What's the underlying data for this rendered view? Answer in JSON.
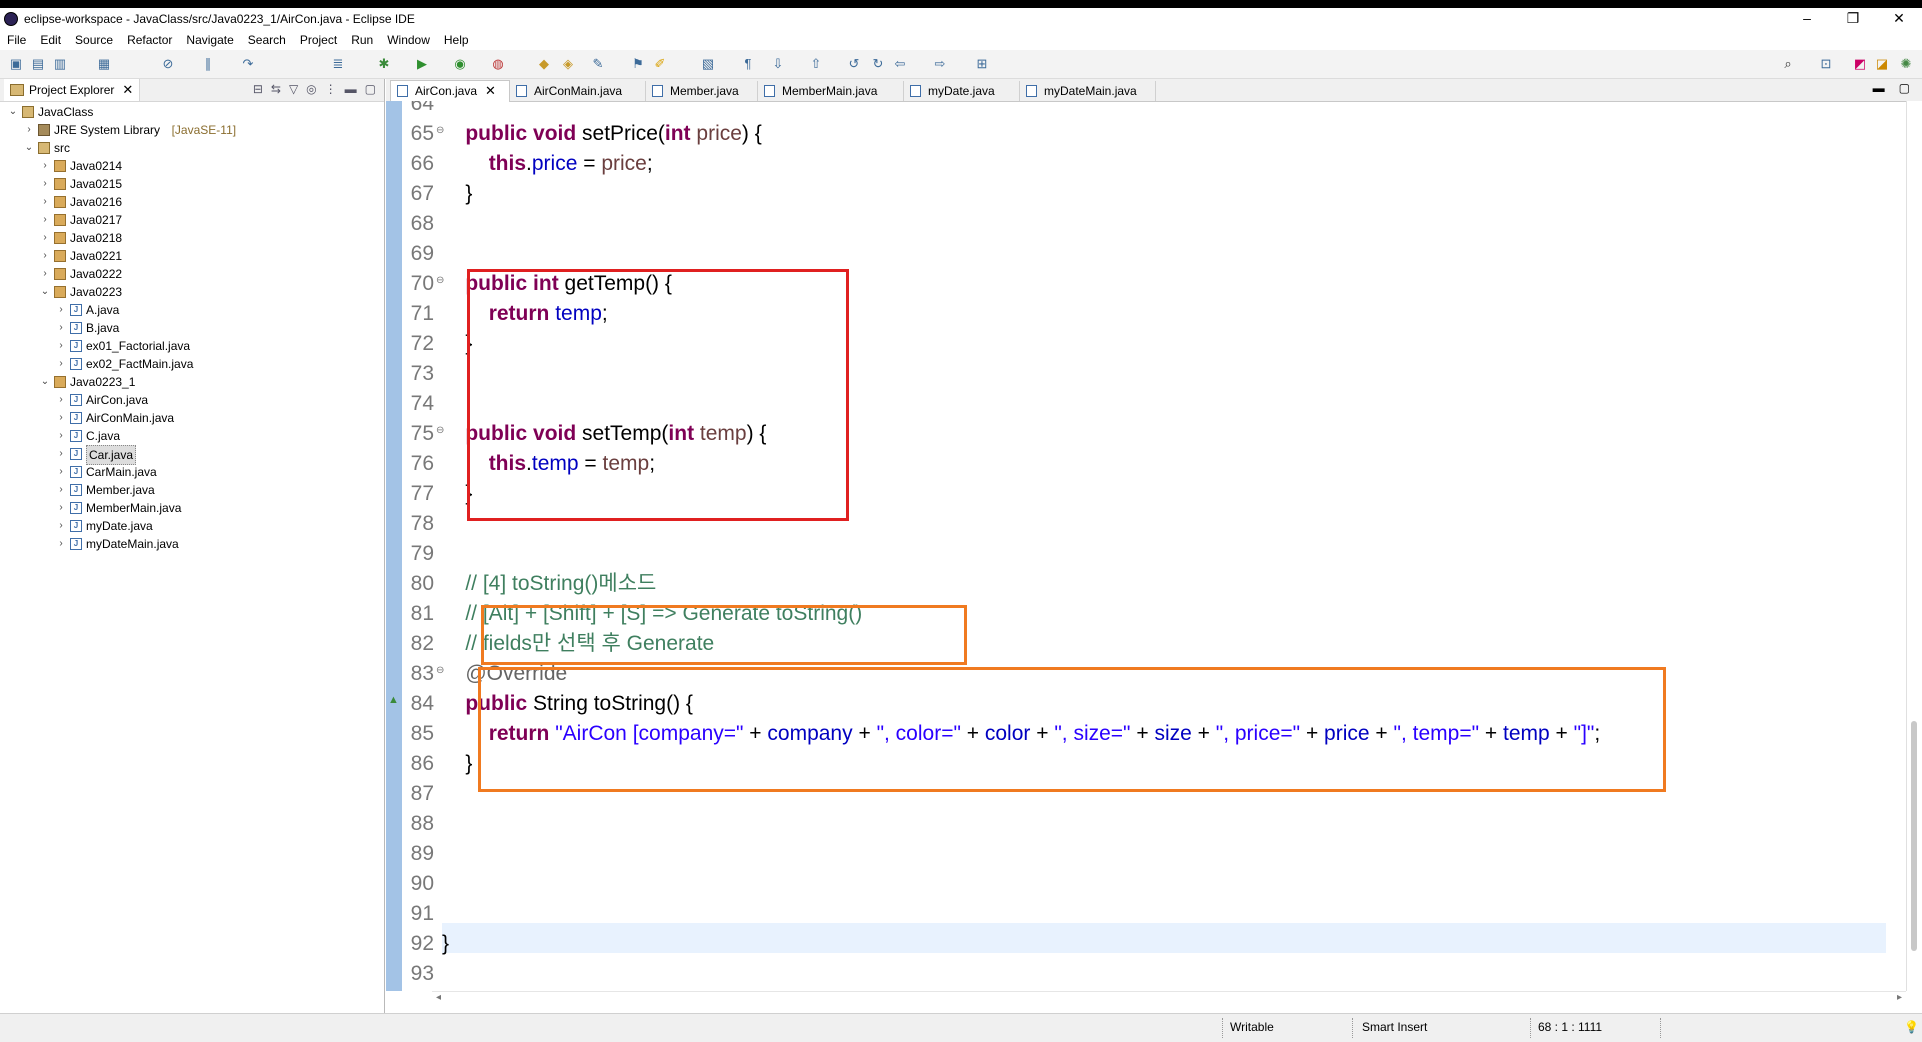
{
  "window": {
    "title": "eclipse-workspace - JavaClass/src/Java0223_1/AirCon.java - Eclipse IDE",
    "minimize": "–",
    "maximize": "❐",
    "close": "✕"
  },
  "menu": [
    "File",
    "Edit",
    "Source",
    "Refactor",
    "Navigate",
    "Search",
    "Project",
    "Run",
    "Window",
    "Help"
  ],
  "explorer": {
    "title": "Project Explorer",
    "tree": [
      {
        "label": "JavaClass",
        "depth": 0,
        "open": true,
        "icon": "project-icon"
      },
      {
        "label": "JRE System Library",
        "sub": "[JavaSE-11]",
        "depth": 1,
        "open": false,
        "icon": "library-icon"
      },
      {
        "label": "src",
        "depth": 1,
        "open": true,
        "icon": "source-folder-icon"
      },
      {
        "label": "Java0214",
        "depth": 2,
        "open": false,
        "icon": "package-icon"
      },
      {
        "label": "Java0215",
        "depth": 2,
        "open": false,
        "icon": "package-icon"
      },
      {
        "label": "Java0216",
        "depth": 2,
        "open": false,
        "icon": "package-icon"
      },
      {
        "label": "Java0217",
        "depth": 2,
        "open": false,
        "icon": "package-icon"
      },
      {
        "label": "Java0218",
        "depth": 2,
        "open": false,
        "icon": "package-icon"
      },
      {
        "label": "Java0221",
        "depth": 2,
        "open": false,
        "icon": "package-icon"
      },
      {
        "label": "Java0222",
        "depth": 2,
        "open": false,
        "icon": "package-icon"
      },
      {
        "label": "Java0223",
        "depth": 2,
        "open": true,
        "icon": "package-icon"
      },
      {
        "label": "A.java",
        "depth": 3,
        "open": false,
        "icon": "java-file-icon"
      },
      {
        "label": "B.java",
        "depth": 3,
        "open": false,
        "icon": "java-file-icon"
      },
      {
        "label": "ex01_Factorial.java",
        "depth": 3,
        "open": false,
        "icon": "java-file-icon"
      },
      {
        "label": "ex02_FactMain.java",
        "depth": 3,
        "open": false,
        "icon": "java-file-icon"
      },
      {
        "label": "Java0223_1",
        "depth": 2,
        "open": true,
        "icon": "package-icon"
      },
      {
        "label": "AirCon.java",
        "depth": 3,
        "open": false,
        "icon": "java-file-icon"
      },
      {
        "label": "AirConMain.java",
        "depth": 3,
        "open": false,
        "icon": "java-file-icon"
      },
      {
        "label": "C.java",
        "depth": 3,
        "open": false,
        "icon": "java-file-icon"
      },
      {
        "label": "Car.java",
        "depth": 3,
        "open": false,
        "icon": "java-file-icon",
        "selected": true
      },
      {
        "label": "CarMain.java",
        "depth": 3,
        "open": false,
        "icon": "java-file-icon"
      },
      {
        "label": "Member.java",
        "depth": 3,
        "open": false,
        "icon": "java-file-icon"
      },
      {
        "label": "MemberMain.java",
        "depth": 3,
        "open": false,
        "icon": "java-file-icon"
      },
      {
        "label": "myDate.java",
        "depth": 3,
        "open": false,
        "icon": "java-file-icon"
      },
      {
        "label": "myDateMain.java",
        "depth": 3,
        "open": false,
        "icon": "java-file-icon"
      }
    ]
  },
  "editor": {
    "tabs": [
      {
        "label": "AirCon.java",
        "active": true
      },
      {
        "label": "AirConMain.java",
        "active": false
      },
      {
        "label": "Member.java",
        "active": false
      },
      {
        "label": "MemberMain.java",
        "active": false
      },
      {
        "label": "myDate.java",
        "active": false
      },
      {
        "label": "myDateMain.java",
        "active": false
      }
    ],
    "lines": [
      {
        "n": "64",
        "parts": []
      },
      {
        "n": "65",
        "fold": true,
        "parts": [
          [
            "    ",
            ""
          ],
          [
            "public",
            "kw"
          ],
          [
            " ",
            ""
          ],
          [
            "void",
            "kw"
          ],
          [
            " setPrice(",
            ""
          ],
          [
            "int",
            "kw"
          ],
          [
            " ",
            ""
          ],
          [
            "price",
            "par"
          ],
          [
            ") {",
            ""
          ]
        ]
      },
      {
        "n": "66",
        "parts": [
          [
            "        ",
            ""
          ],
          [
            "this",
            "kw"
          ],
          [
            ".",
            ""
          ],
          [
            "price",
            "fld"
          ],
          [
            " = ",
            ""
          ],
          [
            "price",
            "par"
          ],
          [
            ";",
            ""
          ]
        ]
      },
      {
        "n": "67",
        "parts": [
          [
            "    }",
            ""
          ]
        ]
      },
      {
        "n": "68",
        "parts": []
      },
      {
        "n": "69",
        "parts": []
      },
      {
        "n": "70",
        "fold": true,
        "parts": [
          [
            "    ",
            ""
          ],
          [
            "public",
            "kw"
          ],
          [
            " ",
            ""
          ],
          [
            "int",
            "kw"
          ],
          [
            " getTemp() {",
            ""
          ]
        ]
      },
      {
        "n": "71",
        "parts": [
          [
            "        ",
            ""
          ],
          [
            "return",
            "kw"
          ],
          [
            " ",
            ""
          ],
          [
            "temp",
            "fld"
          ],
          [
            ";",
            ""
          ]
        ]
      },
      {
        "n": "72",
        "parts": [
          [
            "    }",
            ""
          ]
        ]
      },
      {
        "n": "73",
        "parts": []
      },
      {
        "n": "74",
        "parts": []
      },
      {
        "n": "75",
        "fold": true,
        "parts": [
          [
            "    ",
            ""
          ],
          [
            "public",
            "kw"
          ],
          [
            " ",
            ""
          ],
          [
            "void",
            "kw"
          ],
          [
            " setTemp(",
            ""
          ],
          [
            "int",
            "kw"
          ],
          [
            " ",
            ""
          ],
          [
            "temp",
            "par"
          ],
          [
            ") {",
            ""
          ]
        ]
      },
      {
        "n": "76",
        "parts": [
          [
            "        ",
            ""
          ],
          [
            "this",
            "kw"
          ],
          [
            ".",
            ""
          ],
          [
            "temp",
            "fld"
          ],
          [
            " = ",
            ""
          ],
          [
            "temp",
            "par"
          ],
          [
            ";",
            ""
          ]
        ]
      },
      {
        "n": "77",
        "parts": [
          [
            "    }",
            ""
          ]
        ]
      },
      {
        "n": "78",
        "parts": []
      },
      {
        "n": "79",
        "parts": []
      },
      {
        "n": "80",
        "parts": [
          [
            "    ",
            ""
          ],
          [
            "// [4] toString()메소드",
            "cm"
          ]
        ]
      },
      {
        "n": "81",
        "parts": [
          [
            "    ",
            ""
          ],
          [
            "// [Alt] + [Shift] + [S] => Generate toString()",
            "cm"
          ]
        ]
      },
      {
        "n": "82",
        "parts": [
          [
            "    ",
            ""
          ],
          [
            "// fields만 선택 후 Generate",
            "cm"
          ]
        ]
      },
      {
        "n": "83",
        "fold": true,
        "parts": [
          [
            "    ",
            ""
          ],
          [
            "@Override",
            "ann"
          ]
        ]
      },
      {
        "n": "84",
        "marker": true,
        "parts": [
          [
            "    ",
            ""
          ],
          [
            "public",
            "kw"
          ],
          [
            " String toString() {",
            ""
          ]
        ]
      },
      {
        "n": "85",
        "parts": [
          [
            "        ",
            ""
          ],
          [
            "return",
            "kw"
          ],
          [
            " ",
            ""
          ],
          [
            "\"AirCon [company=\"",
            "str"
          ],
          [
            " + ",
            ""
          ],
          [
            "company",
            "fld"
          ],
          [
            " + ",
            ""
          ],
          [
            "\", color=\"",
            "str"
          ],
          [
            " + ",
            ""
          ],
          [
            "color",
            "fld"
          ],
          [
            " + ",
            ""
          ],
          [
            "\", size=\"",
            "str"
          ],
          [
            " + ",
            ""
          ],
          [
            "size",
            "fld"
          ],
          [
            " + ",
            ""
          ],
          [
            "\", price=\"",
            "str"
          ],
          [
            " + ",
            ""
          ],
          [
            "price",
            "fld"
          ],
          [
            " + ",
            ""
          ],
          [
            "\", temp=\"",
            "str"
          ],
          [
            " + ",
            ""
          ],
          [
            "temp",
            "fld"
          ],
          [
            " + ",
            ""
          ],
          [
            "\"]\"",
            "str"
          ],
          [
            ";",
            ""
          ]
        ]
      },
      {
        "n": "86",
        "parts": [
          [
            "    }",
            ""
          ]
        ]
      },
      {
        "n": "87",
        "parts": []
      },
      {
        "n": "88",
        "parts": []
      },
      {
        "n": "89",
        "parts": []
      },
      {
        "n": "90",
        "parts": []
      },
      {
        "n": "91",
        "parts": []
      },
      {
        "n": "92",
        "parts": [
          [
            "}",
            ""
          ]
        ]
      },
      {
        "n": "93",
        "parts": []
      }
    ]
  },
  "status": {
    "writable": "Writable",
    "insert_mode": "Smart Insert",
    "position": "68 : 1 : 1111"
  }
}
